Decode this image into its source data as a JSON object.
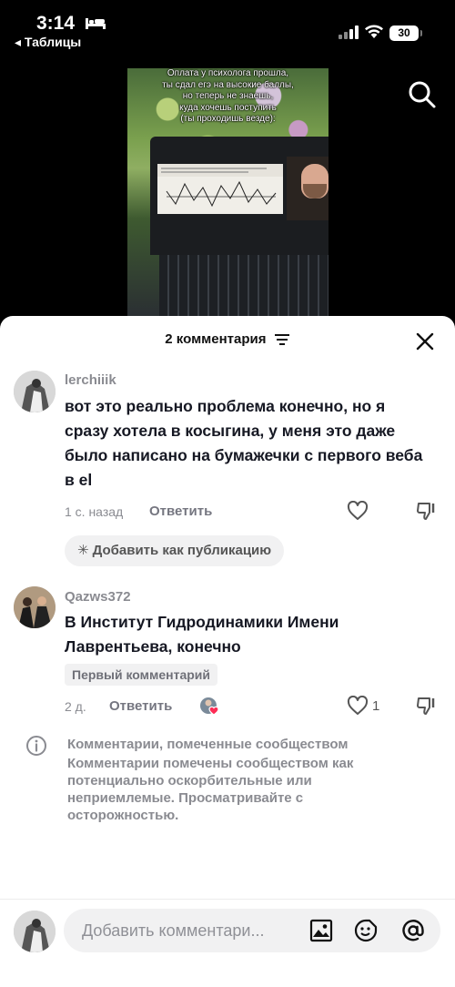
{
  "status_bar": {
    "time": "3:14",
    "back_app": "◂ Таблицы",
    "battery": "30"
  },
  "video": {
    "caption_lines": [
      "Оплата у психолога прошла,",
      "ты сдал егэ на высокие баллы,",
      "но теперь не знаешь,",
      "куда хочешь поступить",
      "(ты проходишь везде):"
    ]
  },
  "comments_sheet": {
    "title": "2 комментария",
    "comments": [
      {
        "username": "lerchiiik",
        "text": "вот это реально проблема конечно, но я сразу хотела в косыгина, у меня это даже было написано на бумажечки с первого веба в el",
        "time": "1 с. назад",
        "reply_label": "Ответить",
        "post_button": "Добавить как публикацию",
        "like_count": ""
      },
      {
        "username": "Qazws372",
        "text": "В Институт Гидродинамики Имени Лаврентьева, конечно",
        "badge": "Первый комментарий",
        "time": "2 д.",
        "reply_label": "Ответить",
        "like_count": "1"
      }
    ],
    "notice": {
      "title": "Комментарии, помеченные сообществом",
      "body": "Комментарии помечены сообществом как потенциально оскорбительные или неприемлемые. Просматривайте с осторожностью."
    },
    "input": {
      "placeholder": "Добавить комментари..."
    }
  },
  "colors": {
    "like_heart": "#fe2c55",
    "muted_text": "#8a8b91"
  }
}
